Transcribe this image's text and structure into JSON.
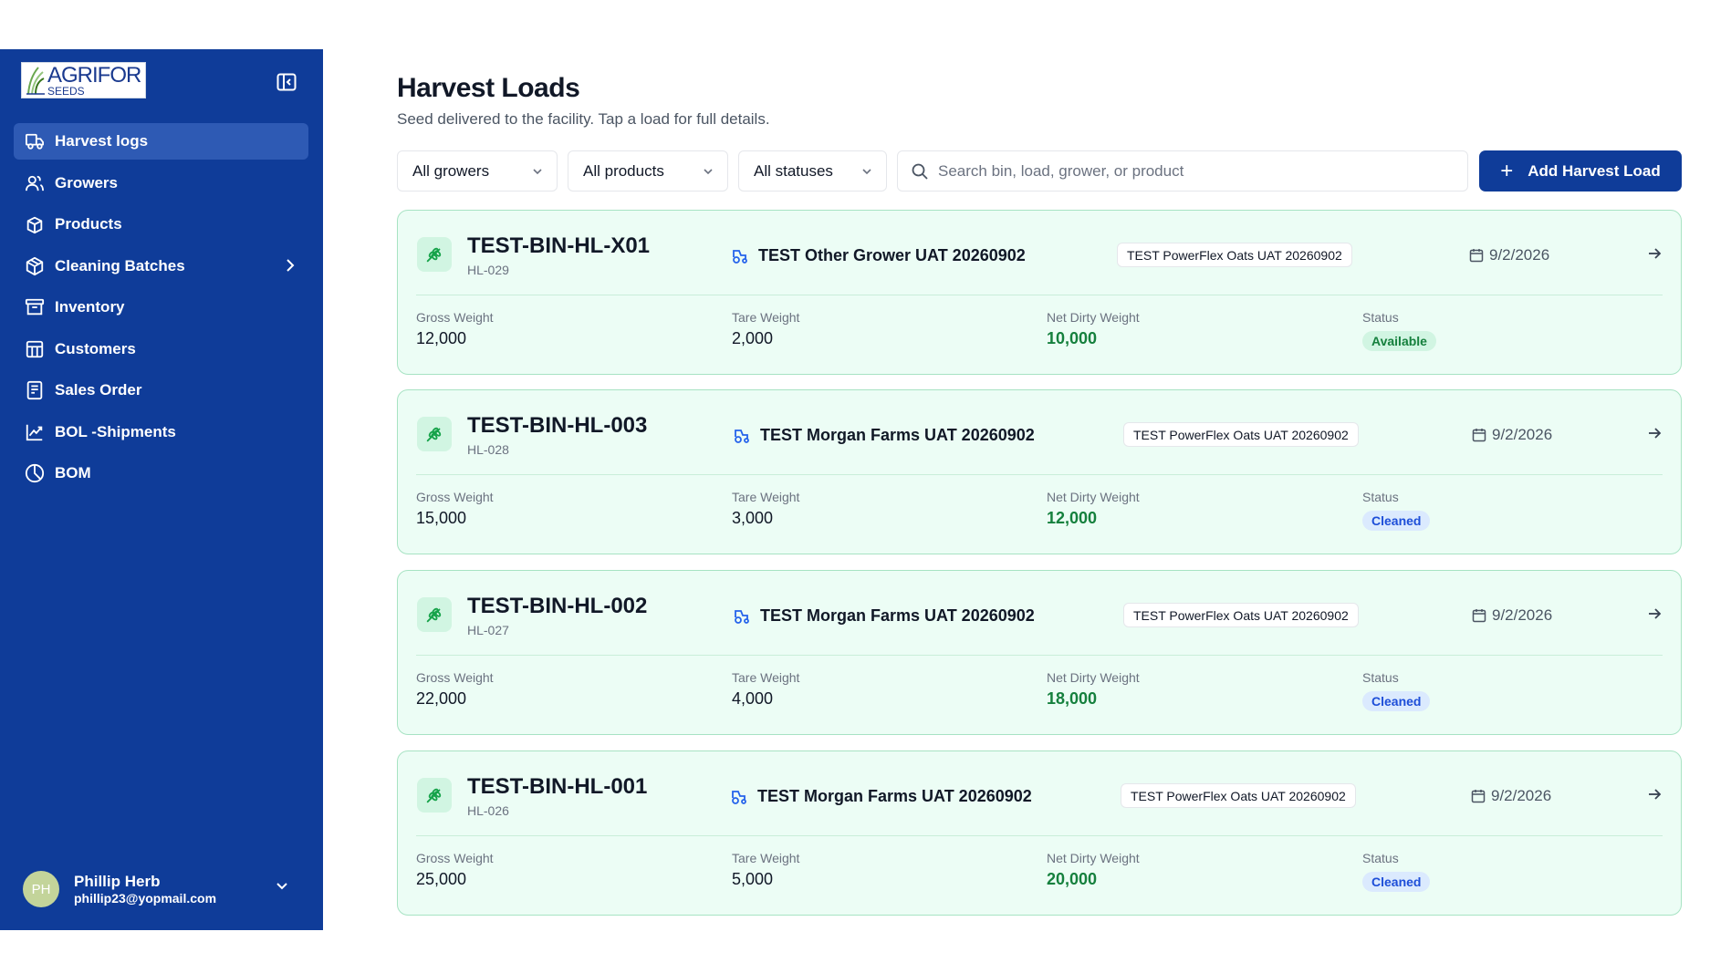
{
  "sidebar": {
    "logo": {
      "brand": "AGRIFOR",
      "sub": "SEEDS"
    },
    "items": [
      {
        "label": "Harvest logs",
        "icon": "truck-icon",
        "active": true
      },
      {
        "label": "Growers",
        "icon": "users-icon"
      },
      {
        "label": "Products",
        "icon": "box-icon"
      },
      {
        "label": "Cleaning Batches",
        "icon": "package-icon",
        "has_children": true
      },
      {
        "label": "Inventory",
        "icon": "archive-icon"
      },
      {
        "label": "Customers",
        "icon": "building-icon"
      },
      {
        "label": "Sales Order",
        "icon": "receipt-icon"
      },
      {
        "label": "BOL -Shipments",
        "icon": "chart-icon"
      },
      {
        "label": "BOM",
        "icon": "pie-icon"
      }
    ],
    "user": {
      "initials": "PH",
      "name": "Phillip Herb",
      "email": "phillip23@yopmail.com"
    }
  },
  "page": {
    "title": "Harvest Loads",
    "subtitle": "Seed delivered to the facility. Tap a load for full details."
  },
  "filters": {
    "growers": "All growers",
    "products": "All products",
    "statuses": "All statuses",
    "search_placeholder": "Search bin, load, grower, or product",
    "add_label": "Add Harvest Load"
  },
  "labels": {
    "gross": "Gross Weight",
    "tare": "Tare Weight",
    "net": "Net Dirty Weight",
    "status": "Status"
  },
  "loads": [
    {
      "bin": "TEST-BIN-HL-X01",
      "id": "HL-029",
      "grower": "TEST Other Grower UAT 20260902",
      "product": "TEST PowerFlex Oats UAT 20260902",
      "date": "9/2/2026",
      "gross": "12,000",
      "tare": "2,000",
      "net": "10,000",
      "status": "Available"
    },
    {
      "bin": "TEST-BIN-HL-003",
      "id": "HL-028",
      "grower": "TEST Morgan Farms UAT 20260902",
      "product": "TEST PowerFlex Oats UAT 20260902",
      "date": "9/2/2026",
      "gross": "15,000",
      "tare": "3,000",
      "net": "12,000",
      "status": "Cleaned"
    },
    {
      "bin": "TEST-BIN-HL-002",
      "id": "HL-027",
      "grower": "TEST Morgan Farms UAT 20260902",
      "product": "TEST PowerFlex Oats UAT 20260902",
      "date": "9/2/2026",
      "gross": "22,000",
      "tare": "4,000",
      "net": "18,000",
      "status": "Cleaned"
    },
    {
      "bin": "TEST-BIN-HL-001",
      "id": "HL-026",
      "grower": "TEST Morgan Farms UAT 20260902",
      "product": "TEST PowerFlex Oats UAT 20260902",
      "date": "9/2/2026",
      "gross": "25,000",
      "tare": "5,000",
      "net": "20,000",
      "status": "Cleaned"
    }
  ],
  "colors": {
    "sidebar": "#0f3c99",
    "sidebar_active": "#2e5ab4",
    "card_bg": "#ecfdf5",
    "net_green": "#15803d",
    "cleaned_blue": "#1d4ed8"
  }
}
